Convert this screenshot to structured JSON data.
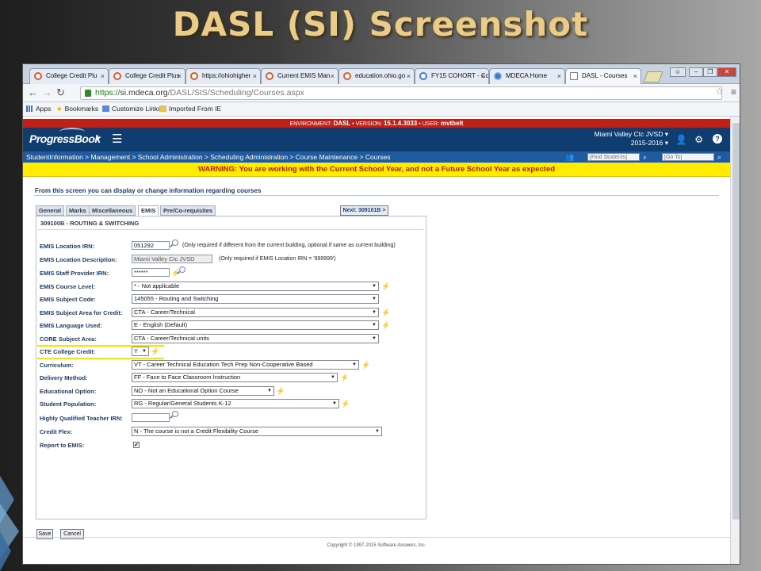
{
  "slide_title": "DASL (SI) Screenshot",
  "tabs": [
    {
      "label": "College Credit Plu",
      "icon": "opera-icon"
    },
    {
      "label": "College Credit Plus",
      "icon": "opera-icon"
    },
    {
      "label": "https://ohiohigher",
      "icon": "opera-icon"
    },
    {
      "label": "Current EMIS Man",
      "icon": "opera-icon"
    },
    {
      "label": "education.ohio.go",
      "icon": "opera-icon"
    },
    {
      "label": "FY15 COHORT - Co",
      "icon": "globe-icon"
    },
    {
      "label": "MDECA Home",
      "icon": "mdeca-icon"
    },
    {
      "label": "DASL - Courses",
      "icon": "document-icon"
    }
  ],
  "address": {
    "scheme": "https://",
    "host": "si.mdeca.org",
    "path": "/DASL/SIS/Scheduling/Courses.aspx"
  },
  "bookmarks": [
    "Apps",
    "Bookmarks",
    "Customize Links",
    "Imported From IE"
  ],
  "env": {
    "prefix": "ENVIRONMENT:",
    "environment": "DASL",
    "version_label": "• VERSION:",
    "version": "15.1.4.3033",
    "user_label": "• USER:",
    "user": "mvtbelt"
  },
  "header": {
    "logo": "ProgressBook",
    "district": "Miami Valley Ctc JVSD ▾",
    "year": "2015-2016 ▾"
  },
  "breadcrumb": "StudentInformation > Management > School Administration > Scheduling Administration > Course Maintenance > Courses",
  "search": {
    "students_placeholder": "[Find Students]",
    "goto_placeholder": "[Go To]"
  },
  "warning": "WARNING: You are working with the Current School Year, and not a Future School Year as expected",
  "intro": "From this screen you can display or change information regarding courses",
  "form_tabs": [
    "General",
    "Marks",
    "Miscellaneous",
    "EMIS",
    "Pre/Co-requisites"
  ],
  "next_button": "Next: 309101B >",
  "panel_title": "309100B - ROUTING & SWITCHING",
  "fields": {
    "location_irn": {
      "label": "EMIS Location IRN:",
      "value": "051292",
      "note": "(Only required if different from the current building, optional if same as current building)"
    },
    "location_desc": {
      "label": "EMIS Location Description:",
      "value": "Miami Valley Ctc JVSD",
      "note": "(Only required if EMIS Location IRN = '999999')"
    },
    "staff_irn": {
      "label": "EMIS Staff Provider IRN:",
      "value": "******"
    },
    "course_level": {
      "label": "EMIS Course Level:",
      "value": "* - Not applicable"
    },
    "subject_code": {
      "label": "EMIS Subject Code:",
      "value": "145055 - Routing and Switching"
    },
    "subject_area": {
      "label": "EMIS Subject Area for Credit:",
      "value": "CTA - Career/Technical"
    },
    "language": {
      "label": "EMIS Language Used:",
      "value": "E - English (Default)"
    },
    "core_subject": {
      "label": "CORE Subject Area:",
      "value": "CTA - Career/Technical units"
    },
    "cte_credit": {
      "label": "CTE College Credit:",
      "value": "Y"
    },
    "curriculum": {
      "label": "Curriculum:",
      "value": "VT - Career Technical Education Tech Prep Non-Cooperative Based"
    },
    "delivery": {
      "label": "Delivery Method:",
      "value": "FF - Face to Face Classroom Instruction"
    },
    "edu_option": {
      "label": "Educational Option:",
      "value": "NO - Not an Educational Option Course"
    },
    "population": {
      "label": "Student Population:",
      "value": "RG - Regular/General Students K-12"
    },
    "hq_teacher": {
      "label": "Highly Qualified Teacher IRN:",
      "value": ""
    },
    "credit_flex": {
      "label": "Credit Flex:",
      "value": "N - The course is not a Credit Flexibility Course"
    },
    "report_emis": {
      "label": "Report to EMIS:",
      "checked": "✔"
    }
  },
  "buttons": {
    "save": "Save",
    "cancel": "Cancel"
  },
  "copyright": "Copyright © 1997-2015 Software Answers, Inc."
}
